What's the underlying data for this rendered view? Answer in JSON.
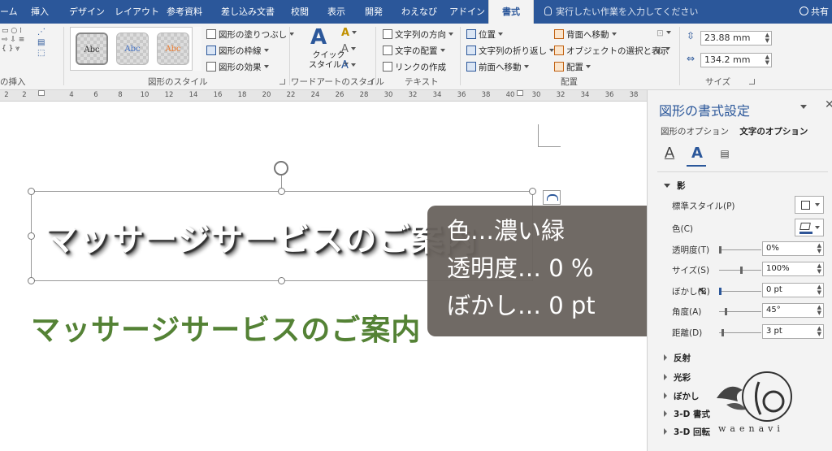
{
  "tabs": [
    "ーム",
    "挿入",
    "デザイン",
    "レイアウト",
    "参考資料",
    "差し込み文書",
    "校閲",
    "表示",
    "開発",
    "わえなび",
    "アドイン",
    "書式"
  ],
  "tell_me": "実行したい作業を入力してください",
  "share": "共有",
  "ribbon": {
    "insert_shapes_group": "の挿入",
    "shape_styles_group": "図形のスタイル",
    "shape_fill": "図形の塗りつぶし",
    "shape_outline": "図形の枠線",
    "shape_effects": "図形の効果",
    "swatch_label": "Abc",
    "quick_style": "クイック",
    "quick_style2": "スタイル",
    "wordart_group": "ワードアートのスタイル",
    "text_direction": "文字列の方向",
    "text_align": "文字の配置",
    "create_link": "リンクの作成",
    "text_group": "テキスト",
    "position": "位置",
    "wrap_text": "文字列の折り返し",
    "bring_forward": "前面へ移動",
    "send_backward": "背面へ移動",
    "selection_pane": "オブジェクトの選択と表示",
    "align": "配置",
    "arrange_group": "配置",
    "height": "23.88 mm",
    "width": "134.2 mm",
    "size_group": "サイズ"
  },
  "ruler": [
    "2",
    "2",
    "4",
    "6",
    "8",
    "10",
    "12",
    "14",
    "16",
    "18",
    "20",
    "22",
    "24",
    "26",
    "28",
    "30",
    "32",
    "34",
    "36",
    "38",
    "40",
    "42"
  ],
  "document": {
    "shadow_text": "マッサージサービスのご案内",
    "green_text": "マッサージサービスのご案内"
  },
  "caption": {
    "line1": "色…濃い緑",
    "line2": "透明度… 0 %",
    "line3": "ぼかし… 0 pt"
  },
  "pane": {
    "title": "図形の書式設定",
    "tab_shape": "図形のオプション",
    "tab_text": "文字のオプション",
    "section_shadow": "影",
    "preset": "標準スタイル(P)",
    "color": "色(C)",
    "transparency": "透明度(T)",
    "transparency_value": "0%",
    "size": "サイズ(S)",
    "size_value": "100%",
    "blur": "ぼかし(B)",
    "blur_value": "0 pt",
    "angle": "角度(A)",
    "angle_value": "45°",
    "distance": "距離(D)",
    "distance_value": "3 pt",
    "reflection": "反射",
    "glow": "光彩",
    "soft_edges": "ぼかし",
    "format_3d": "3-D 書式",
    "rotation_3d": "3-D 回転"
  },
  "watermark": "waenavi",
  "colors": {
    "accent": "#2b579a",
    "shadow_color": "#548235",
    "caption_bg": "#68625d"
  }
}
